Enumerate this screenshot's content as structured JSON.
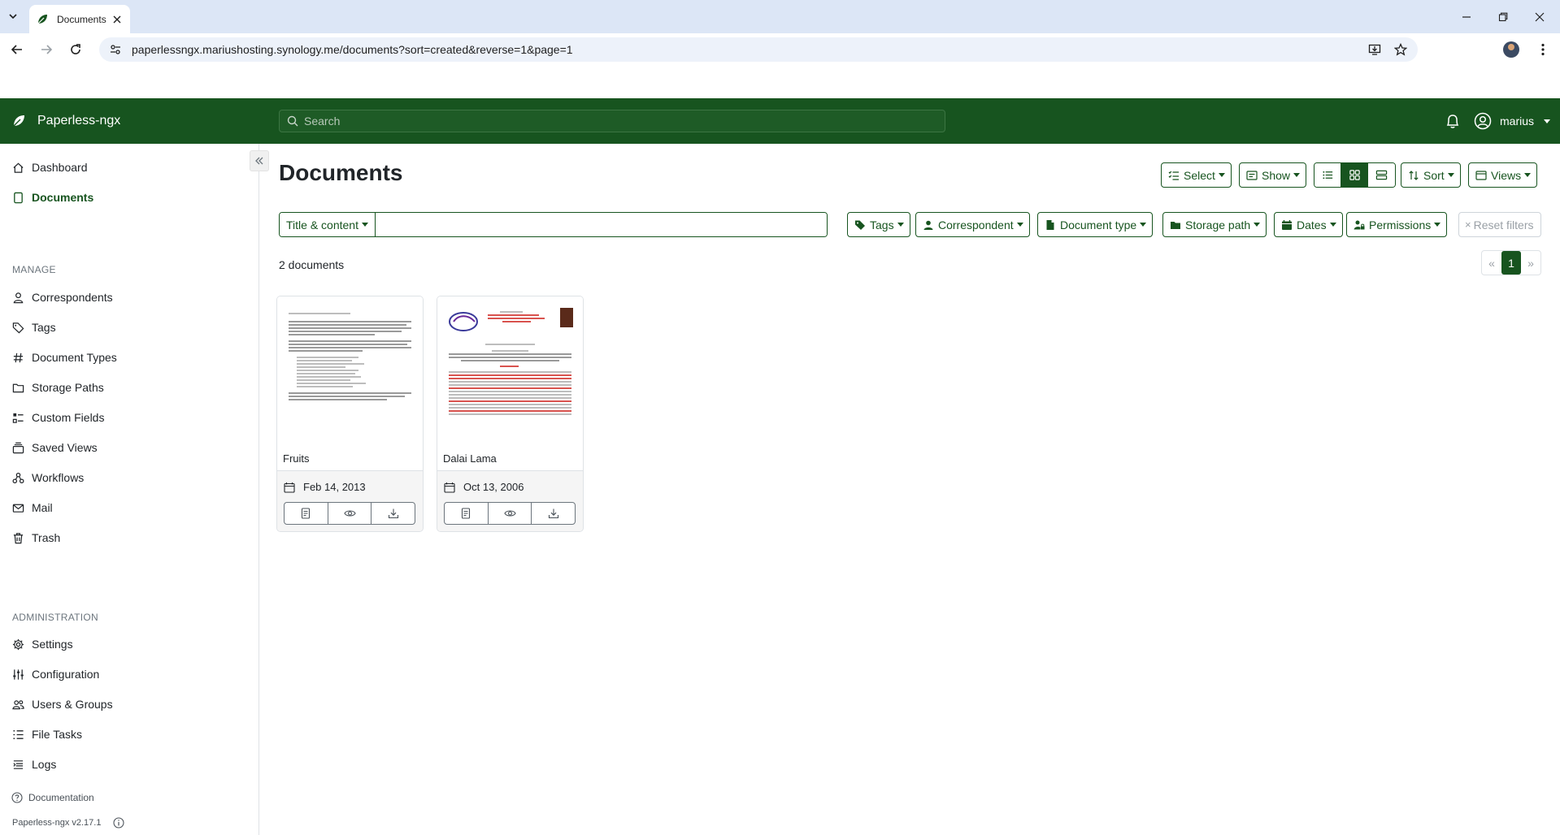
{
  "browser": {
    "tab_title": "Documents",
    "url": "paperlessngx.mariushosting.synology.me/documents?sort=created&reverse=1&page=1"
  },
  "header": {
    "brand": "Paperless-ngx",
    "search_placeholder": "Search",
    "username": "marius"
  },
  "sidebar": {
    "top": [
      {
        "label": "Dashboard",
        "icon": "house-icon"
      },
      {
        "label": "Documents",
        "icon": "file-icon",
        "active": true
      }
    ],
    "manage_heading": "MANAGE",
    "manage": [
      {
        "label": "Correspondents",
        "icon": "person-icon"
      },
      {
        "label": "Tags",
        "icon": "tags-icon"
      },
      {
        "label": "Document Types",
        "icon": "hash-icon"
      },
      {
        "label": "Storage Paths",
        "icon": "folder-icon"
      },
      {
        "label": "Custom Fields",
        "icon": "ui-radios-icon"
      },
      {
        "label": "Saved Views",
        "icon": "collection-icon"
      },
      {
        "label": "Workflows",
        "icon": "diagram-icon"
      },
      {
        "label": "Mail",
        "icon": "envelope-icon"
      },
      {
        "label": "Trash",
        "icon": "trash-icon"
      }
    ],
    "admin_heading": "ADMINISTRATION",
    "admin": [
      {
        "label": "Settings",
        "icon": "gear-icon"
      },
      {
        "label": "Configuration",
        "icon": "sliders-icon"
      },
      {
        "label": "Users & Groups",
        "icon": "people-icon"
      },
      {
        "label": "File Tasks",
        "icon": "list-task-icon"
      },
      {
        "label": "Logs",
        "icon": "text-indent-icon"
      }
    ],
    "documentation": "Documentation",
    "version": "Paperless-ngx v2.17.1"
  },
  "main": {
    "title": "Documents",
    "toolbar": {
      "select": "Select",
      "show": "Show",
      "sort": "Sort",
      "views": "Views"
    },
    "filters": {
      "title_content": "Title & content",
      "query_value": "",
      "tags": "Tags",
      "correspondent": "Correspondent",
      "document_type": "Document type",
      "storage_path": "Storage path",
      "dates": "Dates",
      "permissions": "Permissions",
      "reset": "Reset filters"
    },
    "count": "2 documents",
    "pagination": {
      "prev": "«",
      "current": "1",
      "next": "»"
    },
    "documents": [
      {
        "title": "Fruits",
        "date": "Feb 14, 2013"
      },
      {
        "title": "Dalai Lama",
        "date": "Oct 13, 2006"
      }
    ]
  },
  "colors": {
    "brand_green": "#17541f",
    "tabstrip": "#dce6f6"
  }
}
